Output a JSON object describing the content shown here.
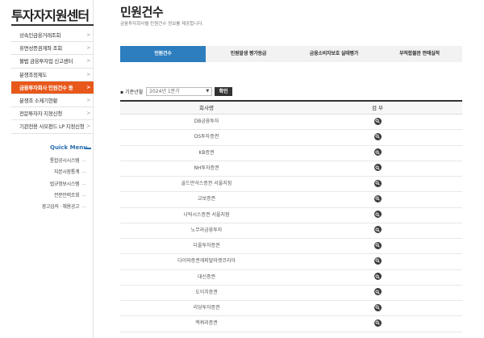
{
  "sidebar": {
    "title": "투자자지원센터",
    "items": [
      {
        "label": "상속인금융거래조회",
        "arrow": ">"
      },
      {
        "label": "휴면성증권계좌 조회",
        "arrow": ">"
      },
      {
        "label": "불법 금융투자업 신고센터",
        "arrow": ">"
      },
      {
        "label": "분쟁조정제도",
        "arrow": ">"
      },
      {
        "label": "금융투자회사 민원건수 등",
        "arrow": ">"
      },
      {
        "label": "분쟁조 소제기현황",
        "arrow": ">"
      },
      {
        "label": "전문투자자 지정신청",
        "arrow": ">"
      },
      {
        "label": "기관전용 사모펀드 LP 지정신청",
        "arrow": ">"
      }
    ],
    "active_index": 4
  },
  "quick_menu": {
    "title": "Quick Menu",
    "items": [
      {
        "label": "통합공시시스템"
      },
      {
        "label": "자본시장통계"
      },
      {
        "label": "법규정보시스템"
      },
      {
        "label": "전문인력조회"
      },
      {
        "label": "광고심의 · 채용공고"
      }
    ]
  },
  "main": {
    "title": "민원건수",
    "description": "금융투자회사별 민원건수 정보를 제공합니다.",
    "tabs": [
      {
        "label": "민원건수"
      },
      {
        "label": "민원발생 평가등급"
      },
      {
        "label": "금융소비자보호 실태평가"
      },
      {
        "label": "부적합불완 판매실적"
      }
    ],
    "active_tab": 0
  },
  "filter": {
    "label": "기준년월",
    "selected": "2024년 1분기",
    "button": "확인"
  },
  "table": {
    "headers": {
      "company": "회사명",
      "view": "검 부"
    },
    "rows": [
      "DB금융투자",
      "DS투자증권",
      "KB증권",
      "NH투자증권",
      "골드만삭스증권 서울지점",
      "교보증권",
      "나틱시스증권 서울지점",
      "노무라금융투자",
      "다올투자증권",
      "다이와증권캐피탈마켓코리아",
      "대신증권",
      "도이치증권",
      "리딩투자증권",
      "맥쿼리증권"
    ]
  },
  "icons": {
    "view": "search-icon",
    "select_caret": "chevron-down-icon",
    "menu_arrow": "chevron-right-icon"
  },
  "colors": {
    "active_menu": "#e8581a",
    "active_tab": "#2c7ebf",
    "quick_menu": "#2c6fb0",
    "button_dark": "#333333"
  }
}
